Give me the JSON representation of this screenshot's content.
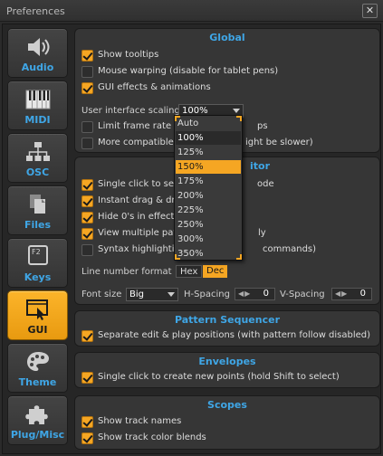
{
  "window": {
    "title": "Preferences",
    "close_glyph": "✕"
  },
  "sidebar": {
    "items": [
      {
        "label": "Audio",
        "icon": "speaker-icon"
      },
      {
        "label": "MIDI",
        "icon": "piano-keys-icon"
      },
      {
        "label": "OSC",
        "icon": "network-icon"
      },
      {
        "label": "Files",
        "icon": "files-icon"
      },
      {
        "label": "Keys",
        "icon": "keyboard-key-icon",
        "key_glyph": "F2"
      },
      {
        "label": "GUI",
        "icon": "cursor-window-icon",
        "active": true
      },
      {
        "label": "Theme",
        "icon": "palette-icon"
      },
      {
        "label": "Plug/Misc",
        "icon": "puzzle-icon"
      }
    ]
  },
  "global": {
    "title": "Global",
    "show_tooltips": "Show tooltips",
    "mouse_warping": "Mouse warping (disable for tablet pens)",
    "gui_effects": "GUI effects & animations",
    "ui_scaling_label": "User interface scaling",
    "ui_scaling_value": "100%",
    "limit_fps_a": "Limit frame rate t",
    "limit_fps_b": "ps",
    "compat_a": "More compatible G",
    "compat_b": "ight be slower)"
  },
  "scaling_dropdown": {
    "options": [
      "Auto",
      "100%",
      "125%",
      "150%",
      "175%",
      "200%",
      "225%",
      "250%",
      "300%",
      "350%"
    ],
    "current": "100%",
    "highlighted": "150%"
  },
  "pattern_editor": {
    "title_partial": "itor",
    "single_click_a": "Single click to set c",
    "single_click_b": "ode",
    "instant_drag": "Instant drag & dro",
    "hide_zeros": "Hide 0's in effect c",
    "view_multiple_a": "View multiple patt",
    "view_multiple_b": "ly",
    "syntax_a": "Syntax highlighting",
    "syntax_b": "commands)",
    "line_number_label": "Line number format",
    "hex": "Hex",
    "dec": "Dec",
    "font_size_label": "Font size",
    "font_size_value": "Big",
    "hspacing_label": "H-Spacing",
    "hspacing_value": "0",
    "vspacing_label": "V-Spacing",
    "vspacing_value": "0"
  },
  "pattern_sequencer": {
    "title": "Pattern Sequencer",
    "separate_positions": "Separate edit & play positions (with pattern follow disabled)"
  },
  "envelopes": {
    "title": "Envelopes",
    "single_click_points": "Single click to create new points (hold Shift to select)"
  },
  "scopes": {
    "title": "Scopes",
    "show_track_names": "Show track names",
    "show_track_color_blends": "Show track color blends"
  },
  "colors": {
    "accent": "#f5a623",
    "heading": "#3fa6e6"
  }
}
